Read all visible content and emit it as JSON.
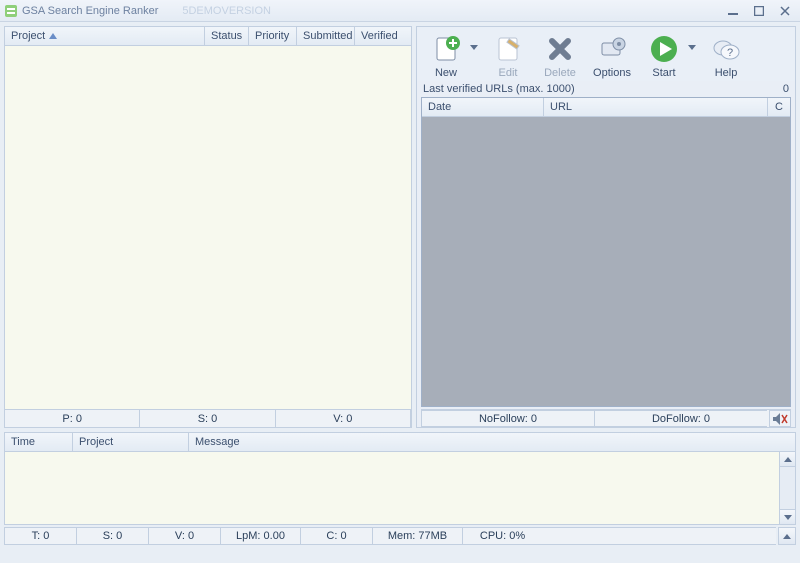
{
  "window": {
    "title": "GSA Search Engine Ranker",
    "subtitle": "5DEMOVERSION"
  },
  "project_grid": {
    "columns": {
      "project": "Project",
      "status": "Status",
      "priority": "Priority",
      "submitted": "Submitted",
      "verified": "Verified"
    },
    "widths": {
      "project": 200,
      "status": 44,
      "priority": 48,
      "submitted": 58,
      "verified": 50
    }
  },
  "left_stats": {
    "p": "P: 0",
    "s": "S: 0",
    "v": "V: 0"
  },
  "toolbar": {
    "new": "New",
    "edit": "Edit",
    "delete": "Delete",
    "options": "Options",
    "start": "Start",
    "help": "Help"
  },
  "urls_caption": "Last verified URLs (max. 1000)",
  "urls_count": "0",
  "url_grid": {
    "columns": {
      "date": "Date",
      "url": "URL",
      "c": "C"
    },
    "widths": {
      "date": 122,
      "url": 214,
      "c": 22
    }
  },
  "right_stats": {
    "nofollow": "NoFollow:  0",
    "dofollow": "DoFollow: 0"
  },
  "log_grid": {
    "columns": {
      "time": "Time",
      "project": "Project",
      "message": "Message"
    },
    "widths": {
      "time": 68,
      "project": 116
    }
  },
  "statusbar": {
    "t": "T: 0",
    "s": "S: 0",
    "v": "V: 0",
    "lpm": "LpM: 0.00",
    "c": "C: 0",
    "mem": "Mem: 77MB",
    "cpu": "CPU: 0%"
  }
}
